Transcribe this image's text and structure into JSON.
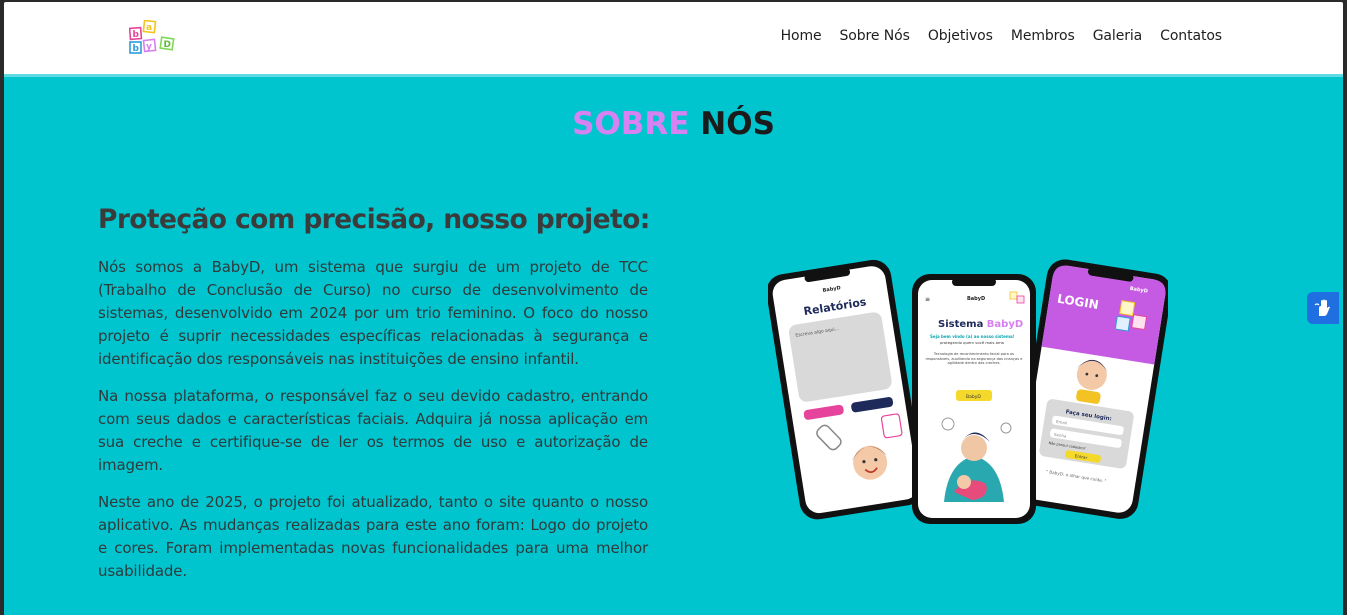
{
  "brand": {
    "logo_letters": [
      "b",
      "a",
      "b",
      "y",
      "D"
    ]
  },
  "nav": {
    "items": [
      {
        "label": "Home"
      },
      {
        "label": "Sobre Nós"
      },
      {
        "label": "Objetivos"
      },
      {
        "label": "Membros"
      },
      {
        "label": "Galeria"
      },
      {
        "label": "Contatos"
      }
    ]
  },
  "section": {
    "title_part1": "SOBRE",
    "title_part2": "NÓS",
    "heading": "Proteção com precisão, nosso projeto:",
    "paragraphs": [
      "Nós somos a BabyD, um sistema que surgiu de um projeto de TCC (Trabalho de Conclusão de Curso) no curso de desenvolvimento de sistemas, desenvolvido em 2024 por um trio feminino. O foco do nosso projeto é suprir necessidades específicas relacionadas à segurança e identificação dos responsáveis nas instituições de ensino infantil.",
      "Na nossa plataforma, o responsável faz o seu devido cadastro, entrando com seus dados e características faciais. Adquira já nossa aplicação em sua creche e certifique-se de ler os termos de uso e autorização de imagem.",
      "Neste ano de 2025, o projeto foi atualizado, tanto o site quanto o nosso aplicativo. As mudanças realizadas para este ano foram: Logo do projeto e cores. Foram implementadas novas funcionalidades para uma melhor usabilidade."
    ]
  },
  "phones": {
    "left": {
      "brand": "BabyD",
      "title": "Relatórios",
      "placeholder": "Escreva algo aqui..."
    },
    "center": {
      "brand": "BabyD",
      "title_prefix": "Sistema ",
      "title_accent": "BabyD",
      "welcome": "Seja bem vindo (a) ao nosso sistema!",
      "tagline": "protegendo quem você mais ama",
      "desc": "Tecnologia de reconhecimento facial para os responsáveis, auxiliando na segurança das crianças e agilidade dentro das creches.",
      "button": "BabyD"
    },
    "right": {
      "brand": "BabyD",
      "title": "LOGIN",
      "form_title": "Faça seu login:",
      "email": "Email",
      "password": "Senha",
      "signup": "Não possui cadastro?",
      "button": "Entrar",
      "quote": "\" BabyD: o olhar que cuida. \""
    }
  },
  "colors": {
    "page_bg": "#00c5cf",
    "accent_purple": "#d682f2",
    "header_bg": "#ffffff",
    "login_header": "#c65be3",
    "yellow": "#f5d92a",
    "access_blue": "#1f6fe0"
  },
  "icons": {
    "accessibility": "hand-accessibility-icon"
  }
}
